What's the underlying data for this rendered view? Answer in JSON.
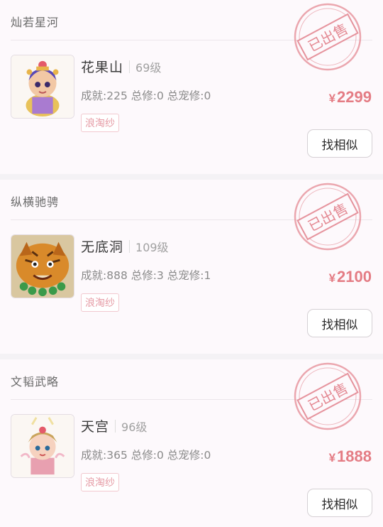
{
  "listings": [
    {
      "server": "灿若星河",
      "role": "花果山",
      "level": "69级",
      "stats": "成就:225 总修:0 总宠修:0",
      "tag": "浪淘纱",
      "price_symbol": "¥",
      "price": "2299",
      "stamp": "已出售",
      "similar_label": "找相似",
      "avatar_icon": "character-avatar-flower-fruit-icon"
    },
    {
      "server": "纵横驰骋",
      "role": "无底洞",
      "level": "109级",
      "stats": "成就:888 总修:3 总宠修:1",
      "tag": "浪淘纱",
      "price_symbol": "¥",
      "price": "2100",
      "stamp": "已出售",
      "similar_label": "找相似",
      "avatar_icon": "character-avatar-tiger-icon"
    },
    {
      "server": "文韬武略",
      "role": "天宫",
      "level": "96级",
      "stats": "成就:365 总修:0 总宠修:0",
      "tag": "浪淘纱",
      "price_symbol": "¥",
      "price": "1888",
      "stamp": "已出售",
      "similar_label": "找相似",
      "avatar_icon": "character-avatar-heaven-palace-icon"
    }
  ],
  "colors": {
    "price": "#e47c84",
    "stamp": "#e48a94",
    "tag": "#e59aa4",
    "background": "#fdf9fc"
  }
}
